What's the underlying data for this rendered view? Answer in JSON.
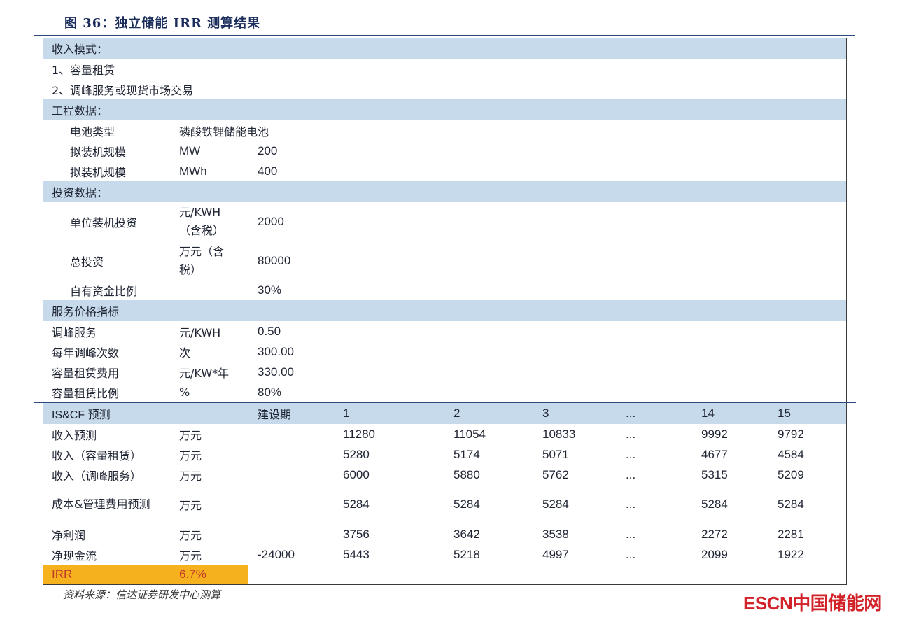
{
  "title": "图 36：独立储能 IRR 测算结果",
  "sections": {
    "income_mode": "收入模式：",
    "engineering": "工程数据：",
    "investment": "投资数据：",
    "price": "服务价格指标"
  },
  "income_modes": [
    "1、容量租赁",
    "2、调峰服务或现货市场交易"
  ],
  "engineering_rows": [
    {
      "label": "电池类型",
      "unit": "磷酸铁锂储能电池",
      "value": ""
    },
    {
      "label": "拟装机规模",
      "unit": "MW",
      "value": "200"
    },
    {
      "label": "拟装机规模",
      "unit": "MWh",
      "value": "400"
    }
  ],
  "investment_rows": [
    {
      "label": "单位装机投资",
      "unit": "元/KWH（含税）",
      "value": "2000"
    },
    {
      "label": "总投资",
      "unit": "万元（含税）",
      "value": "80000"
    },
    {
      "label": "自有资金比例",
      "unit": "",
      "value": "30%"
    }
  ],
  "price_rows": [
    {
      "label": "调峰服务",
      "unit": "元/KWH",
      "value": "0.50"
    },
    {
      "label": "每年调峰次数",
      "unit": "次",
      "value": "300.00"
    },
    {
      "label": "容量租赁费用",
      "unit": "元/KW*年",
      "value": "330.00"
    },
    {
      "label": "容量租赁比例",
      "unit": "%",
      "value": "80%"
    }
  ],
  "iscf_header": [
    "IS&CF 预测",
    "",
    "建设期",
    "1",
    "2",
    "3",
    "...",
    "14",
    "15"
  ],
  "iscf_rows": [
    [
      "收入预测",
      "万元",
      "",
      "11280",
      "11054",
      "10833",
      "...",
      "9992",
      "9792"
    ],
    [
      "收入（容量租赁）",
      "万元",
      "",
      "5280",
      "5174",
      "5071",
      "...",
      "4677",
      "4584"
    ],
    [
      "收入（调峰服务）",
      "万元",
      "",
      "6000",
      "5880",
      "5762",
      "...",
      "5315",
      "5209"
    ],
    [
      "成本&管理费用预测",
      "万元",
      "",
      "5284",
      "5284",
      "5284",
      "...",
      "5284",
      "5284"
    ],
    [
      "净利润",
      "万元",
      "",
      "3756",
      "3642",
      "3538",
      "...",
      "2272",
      "2281"
    ],
    [
      "净现金流",
      "万元",
      "-24000",
      "5443",
      "5218",
      "4997",
      "...",
      "2099",
      "1922"
    ]
  ],
  "irr": {
    "label": "IRR",
    "value": "6.7%"
  },
  "source": "资料来源：信达证券研发中心测算",
  "watermark": "ESCN中国储能网",
  "colors": {
    "band": "#c6daeb",
    "irr_fill": "#f6b21e",
    "irr_text": "#c0392b",
    "rule": "#2e4a7d"
  }
}
